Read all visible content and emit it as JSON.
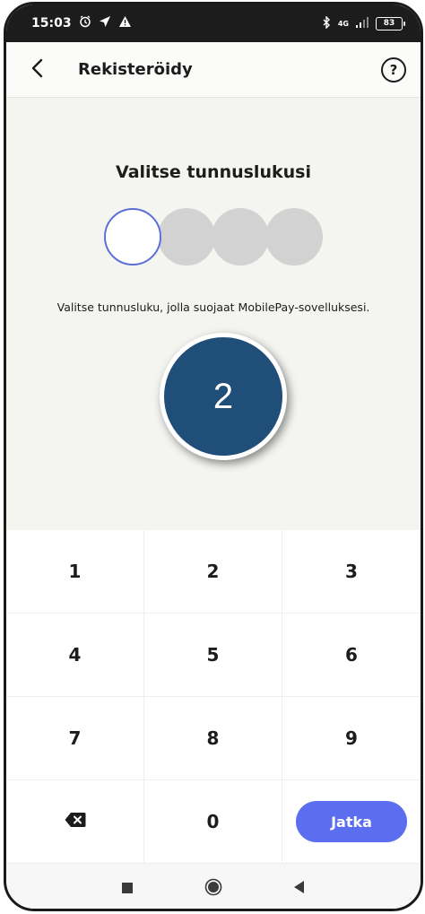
{
  "statusbar": {
    "time": "15:03",
    "network": "4G",
    "battery": "83"
  },
  "appbar": {
    "title": "Rekisteröidy",
    "help_label": "?"
  },
  "pin": {
    "heading": "Valitse tunnuslukusi",
    "description": "Valitse tunnusluku, jolla suojaat MobilePay-sovelluksesi.",
    "entered_digits": 0,
    "total_digits": 4
  },
  "step_badge": "2",
  "keypad": {
    "keys": [
      "1",
      "2",
      "3",
      "4",
      "5",
      "6",
      "7",
      "8",
      "9"
    ],
    "zero": "0",
    "submit_label": "Jatka"
  },
  "colors": {
    "accent": "#5c6ef0",
    "badge": "#1f4e79",
    "active_dot_border": "#5b6fd8",
    "inactive_dot": "#d2d2d2"
  },
  "icons": {
    "back": "chevron-left-icon",
    "help": "question-circle-icon",
    "backspace": "backspace-icon",
    "nav_recent": "square-icon",
    "nav_home": "circle-icon",
    "nav_back": "triangle-left-icon"
  }
}
